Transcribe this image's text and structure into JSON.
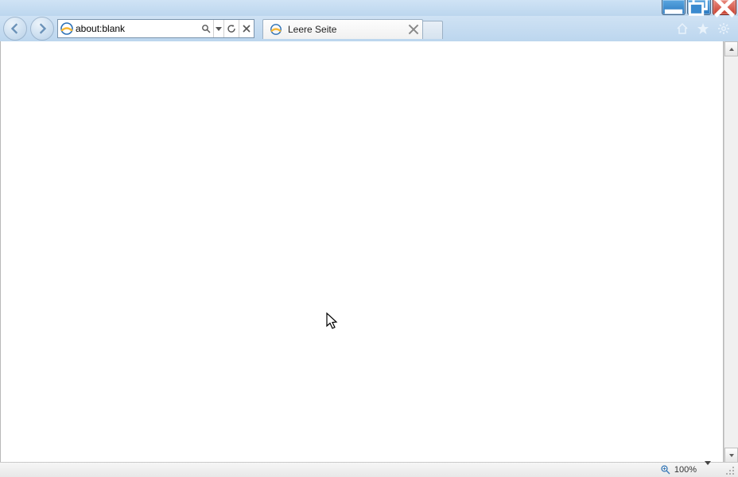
{
  "window": {
    "controls": {
      "minimize": "minimize",
      "maximize": "restore",
      "close": "close"
    }
  },
  "nav": {
    "back_tooltip": "Back",
    "forward_tooltip": "Forward"
  },
  "address": {
    "url": "about:blank",
    "search_tooltip": "Search",
    "dropdown_tooltip": "Show options",
    "refresh_tooltip": "Refresh",
    "stop_tooltip": "Stop"
  },
  "tabs": [
    {
      "title": "Leere Seite",
      "close_tooltip": "Close tab"
    }
  ],
  "newtab_tooltip": "New tab",
  "toolbar": {
    "home_tooltip": "Home",
    "favorites_tooltip": "Favorites",
    "tools_tooltip": "Tools"
  },
  "status": {
    "zoom_label": "100%"
  }
}
